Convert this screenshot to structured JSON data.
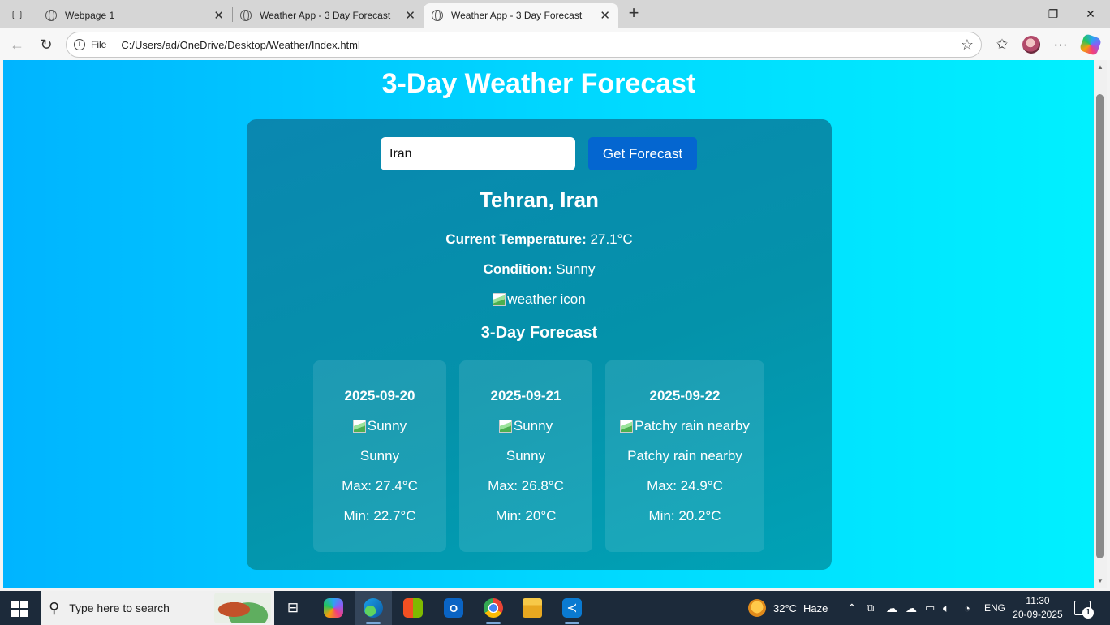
{
  "browser": {
    "tabs": [
      {
        "title": "Webpage 1",
        "close": "✕"
      },
      {
        "title": "Weather App - 3 Day Forecast",
        "close": "✕"
      },
      {
        "title": "Weather App - 3 Day Forecast",
        "close": "✕"
      }
    ],
    "active_tab_index": 2,
    "new_tab": "+",
    "address": {
      "scheme_label": "File",
      "url": "C:/Users/ad/OneDrive/Desktop/Weather/Index.html"
    },
    "window_controls": {
      "minimize": "—",
      "maximize": "❐",
      "close": "✕"
    }
  },
  "page": {
    "title": "3-Day Weather Forecast",
    "search": {
      "value": "Iran",
      "button_label": "Get Forecast"
    },
    "location": "Tehran, Iran",
    "current": {
      "temp_label": "Current Temperature:",
      "temp_value": "27.1°C",
      "condition_label": "Condition:",
      "condition_value": "Sunny",
      "icon_alt": "weather icon"
    },
    "forecast_title": "3-Day Forecast",
    "days": [
      {
        "date": "2025-09-20",
        "icon_alt": "Sunny",
        "condition": "Sunny",
        "max": "Max: 27.4°C",
        "min": "Min: 22.7°C"
      },
      {
        "date": "2025-09-21",
        "icon_alt": "Sunny",
        "condition": "Sunny",
        "max": "Max: 26.8°C",
        "min": "Min: 20°C"
      },
      {
        "date": "2025-09-22",
        "icon_alt": "Patchy rain nearby",
        "condition": "Patchy rain nearby",
        "max": "Max: 24.9°C",
        "min": "Min: 20.2°C"
      }
    ]
  },
  "taskbar": {
    "search_placeholder": "Type here to search",
    "weather": {
      "temp": "32°C",
      "condition": "Haze"
    },
    "language": "ENG",
    "time": "11:30",
    "date": "20-09-2025",
    "notification_count": "1"
  },
  "colors": {
    "accent_button": "#0466d0",
    "page_gradient_start": "#00b4ff",
    "page_gradient_end": "#00f0ff",
    "card": "#0492aa"
  }
}
